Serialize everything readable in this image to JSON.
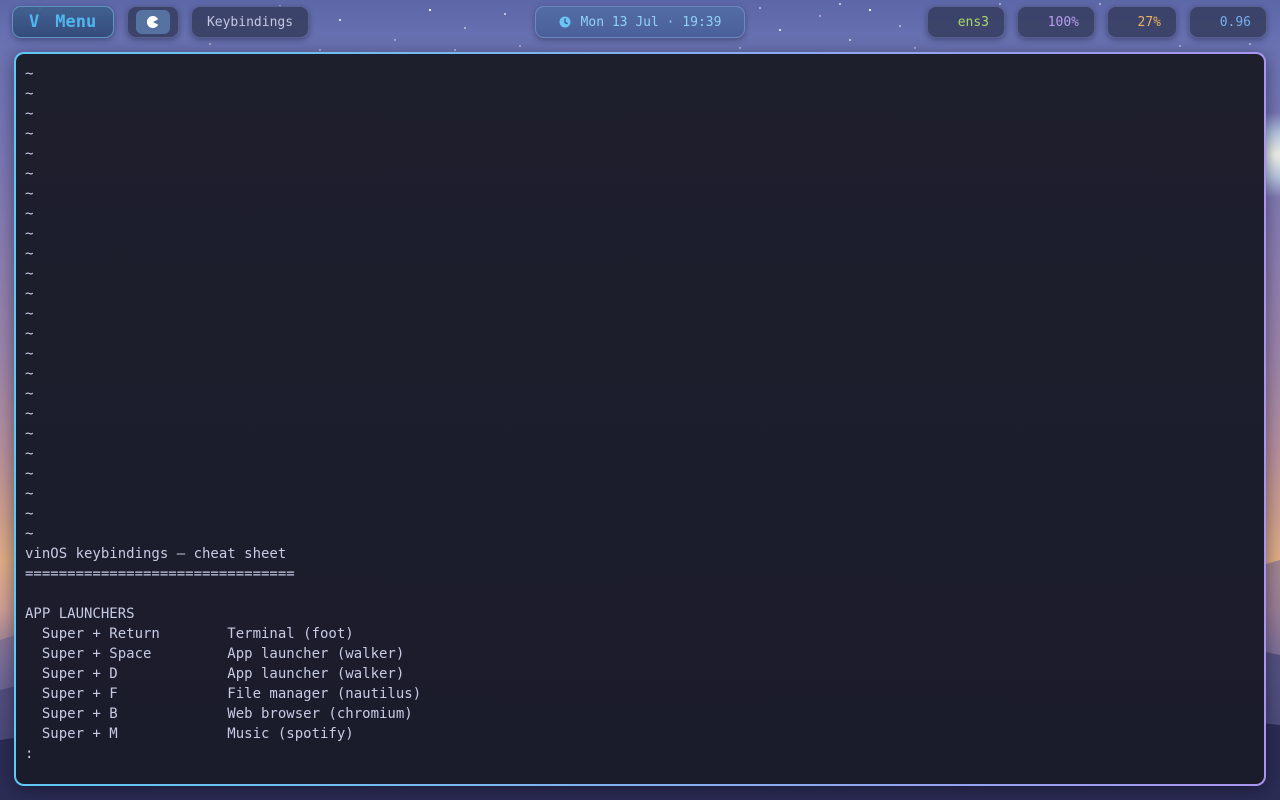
{
  "topbar": {
    "menu": {
      "logo": "V",
      "label": "Menu"
    },
    "workspace_icon": "pacman-icon",
    "window_title": "Keybindings",
    "clock": {
      "text": "Mon 13 Jul · 19:39",
      "icon": "clock-icon"
    },
    "status": {
      "network": "ens3",
      "volume": "100%",
      "cpu": "27%",
      "load": "0.96"
    },
    "colors": {
      "accent": "#4fb6f0",
      "clock_text": "#8fd2f6",
      "network": "#a9d86e",
      "volume": "#b79cf0",
      "cpu": "#ecb060",
      "load": "#78aef0"
    }
  },
  "terminal": {
    "empty_line_marker": "~",
    "lines": [
      "vinOS keybindings — cheat sheet",
      "================================",
      "",
      "APP LAUNCHERS",
      "  Super + Return        Terminal (foot)",
      "  Super + Space         App launcher (walker)",
      "  Super + D             App launcher (walker)",
      "  Super + F             File manager (nautilus)",
      "  Super + B             Web browser (chromium)",
      "  Super + M             Music (spotify)"
    ],
    "prompt": ":",
    "colors": {
      "background": "#1e1f2d",
      "text": "#c6cae3",
      "border_start": "#5fc8f2",
      "border_end": "#a995ef"
    }
  }
}
